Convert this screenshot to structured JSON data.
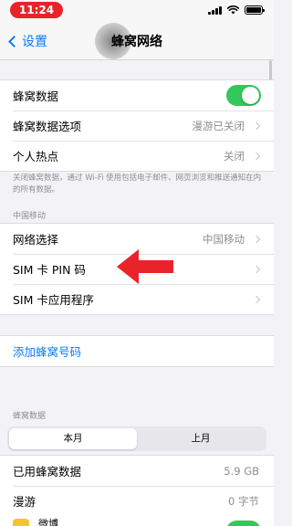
{
  "status_bar": {
    "time": "11:24",
    "accent": "#e8242a"
  },
  "nav": {
    "back_label": "设置",
    "title": "蜂窝网络"
  },
  "cellular_group": {
    "cellular_data_label": "蜂窝数据",
    "cellular_data_on": true,
    "options_label": "蜂窝数据选项",
    "options_value": "漫游已关闭",
    "hotspot_label": "个人热点",
    "hotspot_value": "关闭"
  },
  "cellular_footnote": "关闭蜂窝数据，通过 Wi-Fi 使用包括电子邮件、网页浏览和推送通知在内的所有数据。",
  "carrier_section": {
    "header": "中国移动",
    "network_label": "网络选择",
    "network_value": "中国移动",
    "sim_pin_label": "SIM 卡 PIN 码",
    "sim_apps_label": "SIM 卡应用程序"
  },
  "add_plan_label": "添加蜂窝号码",
  "usage_section": {
    "header": "蜂窝数据",
    "segments": [
      "本月",
      "上月"
    ],
    "selected_segment": "本月",
    "used_label": "已用蜂窝数据",
    "used_value": "5.9 GB",
    "roaming_label": "漫游",
    "roaming_value": "0 字节",
    "next_app_label": "微博"
  },
  "colors": {
    "accent": "#0a7aff",
    "toggle_on": "#34c759",
    "annotation_arrow": "#e8242a"
  }
}
